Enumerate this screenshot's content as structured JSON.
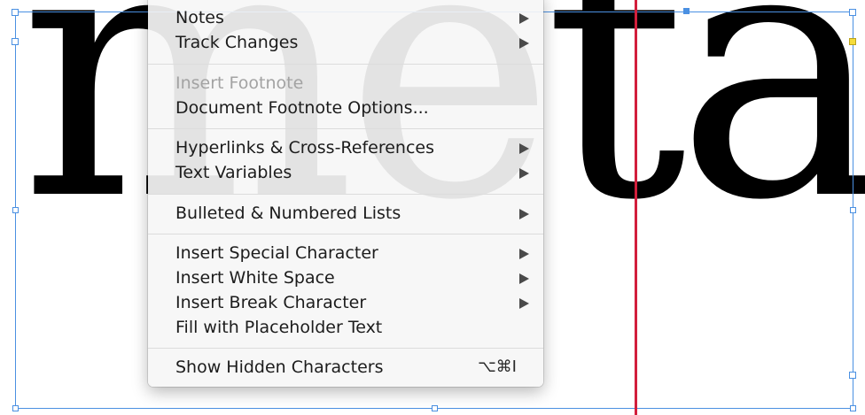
{
  "document": {
    "word": "metal"
  },
  "menu": {
    "items": [
      {
        "label": "Notes",
        "submenu": true,
        "disabled": false
      },
      {
        "label": "Track Changes",
        "submenu": true,
        "disabled": false
      },
      {
        "label": "Insert Footnote",
        "submenu": false,
        "disabled": true
      },
      {
        "label": "Document Footnote Options...",
        "submenu": false,
        "disabled": false
      },
      {
        "label": "Hyperlinks & Cross-References",
        "submenu": true,
        "disabled": false
      },
      {
        "label": "Text Variables",
        "submenu": true,
        "disabled": false
      },
      {
        "label": "Bulleted & Numbered Lists",
        "submenu": true,
        "disabled": false
      },
      {
        "label": "Insert Special Character",
        "submenu": true,
        "disabled": false
      },
      {
        "label": "Insert White Space",
        "submenu": true,
        "disabled": false
      },
      {
        "label": "Insert Break Character",
        "submenu": true,
        "disabled": false
      },
      {
        "label": "Fill with Placeholder Text",
        "submenu": false,
        "disabled": false
      },
      {
        "label": "Show Hidden Characters",
        "submenu": false,
        "disabled": false,
        "shortcut": "⌥⌘I"
      }
    ]
  },
  "colors": {
    "frame_outline": "#4a90e2",
    "guide": "#d21f3c",
    "disabled_text": "#a3a3a3"
  }
}
